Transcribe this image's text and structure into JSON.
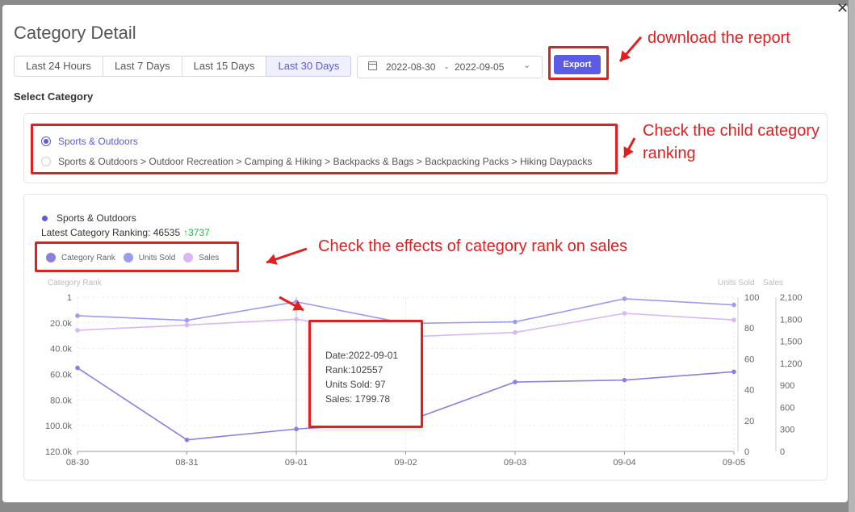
{
  "modal": {
    "title": "Category Detail",
    "close_glyph": "✕",
    "time_tabs": [
      {
        "label": "Last 24 Hours",
        "active": false
      },
      {
        "label": "Last 7 Days",
        "active": false
      },
      {
        "label": "Last 15 Days",
        "active": false
      },
      {
        "label": "Last 30 Days",
        "active": true
      }
    ],
    "date_range": {
      "start": "2022-08-30",
      "separator": "-",
      "end": "2022-09-05"
    },
    "export_label": "Export",
    "select_category_label": "Select Category",
    "categories": [
      {
        "label": "Sports & Outdoors",
        "selected": true
      },
      {
        "label": "Sports & Outdoors > Outdoor Recreation > Camping & Hiking > Backpacks & Bags > Backpacking Packs > Hiking Daypacks",
        "selected": false
      }
    ]
  },
  "summary": {
    "category_name": "Sports & Outdoors",
    "ranking_label": "Latest Category Ranking: 46535",
    "ranking_change": "3737",
    "ranking_change_arrow": "↑"
  },
  "annotations": {
    "download": "download the report",
    "child_line1": "Check the child category",
    "child_line2": "ranking",
    "effects": "Check the effects of category rank on sales"
  },
  "tooltip": {
    "date": "Date:2022-09-01",
    "rank": "Rank:102557",
    "units": "Units Sold: 97",
    "sales": "Sales: 1799.78"
  },
  "chart_data": {
    "type": "line",
    "x": [
      "08-30",
      "08-31",
      "09-01",
      "09-02",
      "09-03",
      "09-04",
      "09-05"
    ],
    "series": [
      {
        "name": "Category Rank",
        "axis": "left",
        "color": "#8b7fe0",
        "values": [
          55000,
          111000,
          102557,
          97000,
          66000,
          64500,
          58000
        ]
      },
      {
        "name": "Units Sold",
        "axis": "right",
        "color": "#9d9bf0",
        "values": [
          88,
          85,
          97,
          83,
          84,
          99,
          95
        ]
      },
      {
        "name": "Sales",
        "axis": "right2",
        "color": "#d9b6f5",
        "values": [
          1650,
          1720,
          1799.78,
          1560,
          1620,
          1880,
          1790
        ]
      }
    ],
    "axes": {
      "left": {
        "label": "Category Rank",
        "inverted": true,
        "range": [
          1,
          120000
        ],
        "ticks": [
          "1",
          "20.0k",
          "40.0k",
          "60.0k",
          "80.0k",
          "100.0k",
          "120.0k"
        ]
      },
      "right": {
        "label": "Units Sold",
        "range": [
          0,
          100
        ],
        "ticks": [
          "100",
          "80",
          "60",
          "40",
          "20",
          "0"
        ]
      },
      "right2": {
        "label": "Sales",
        "range": [
          0,
          2100
        ],
        "ticks": [
          "2,100",
          "1,800",
          "1,500",
          "1,200",
          "900",
          "600",
          "300",
          "0"
        ]
      }
    },
    "grid": true,
    "legend_position": "top-left",
    "highlight_x": "09-01"
  }
}
